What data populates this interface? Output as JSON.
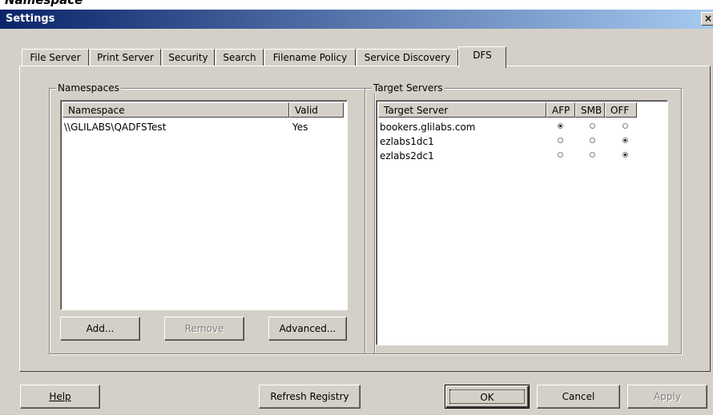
{
  "window": {
    "title": "Settings",
    "close_glyph": "×",
    "background_text": "Namespace"
  },
  "tabs": [
    {
      "label": "File Server"
    },
    {
      "label": "Print Server"
    },
    {
      "label": "Security"
    },
    {
      "label": "Search"
    },
    {
      "label": "Filename Policy"
    },
    {
      "label": "Service Discovery"
    },
    {
      "label": "DFS",
      "active": true
    }
  ],
  "namespaces": {
    "group_label": "Namespaces",
    "columns": [
      "Namespace",
      "Valid"
    ],
    "rows": [
      {
        "namespace": "\\\\GLILABS\\QADFSTest",
        "valid": "Yes"
      }
    ],
    "buttons": {
      "add": "Add...",
      "remove": "Remove",
      "advanced": "Advanced..."
    }
  },
  "targets": {
    "group_label": "Target Servers",
    "columns": [
      "Target Server",
      "AFP",
      "SMB",
      "OFF"
    ],
    "rows": [
      {
        "server": "bookers.glilabs.com",
        "selected": "AFP"
      },
      {
        "server": "ezlabs1dc1",
        "selected": "OFF"
      },
      {
        "server": "ezlabs2dc1",
        "selected": "OFF"
      }
    ]
  },
  "footer": {
    "help": "Help",
    "refresh": "Refresh Registry",
    "ok": "OK",
    "cancel": "Cancel",
    "apply": "Apply"
  }
}
